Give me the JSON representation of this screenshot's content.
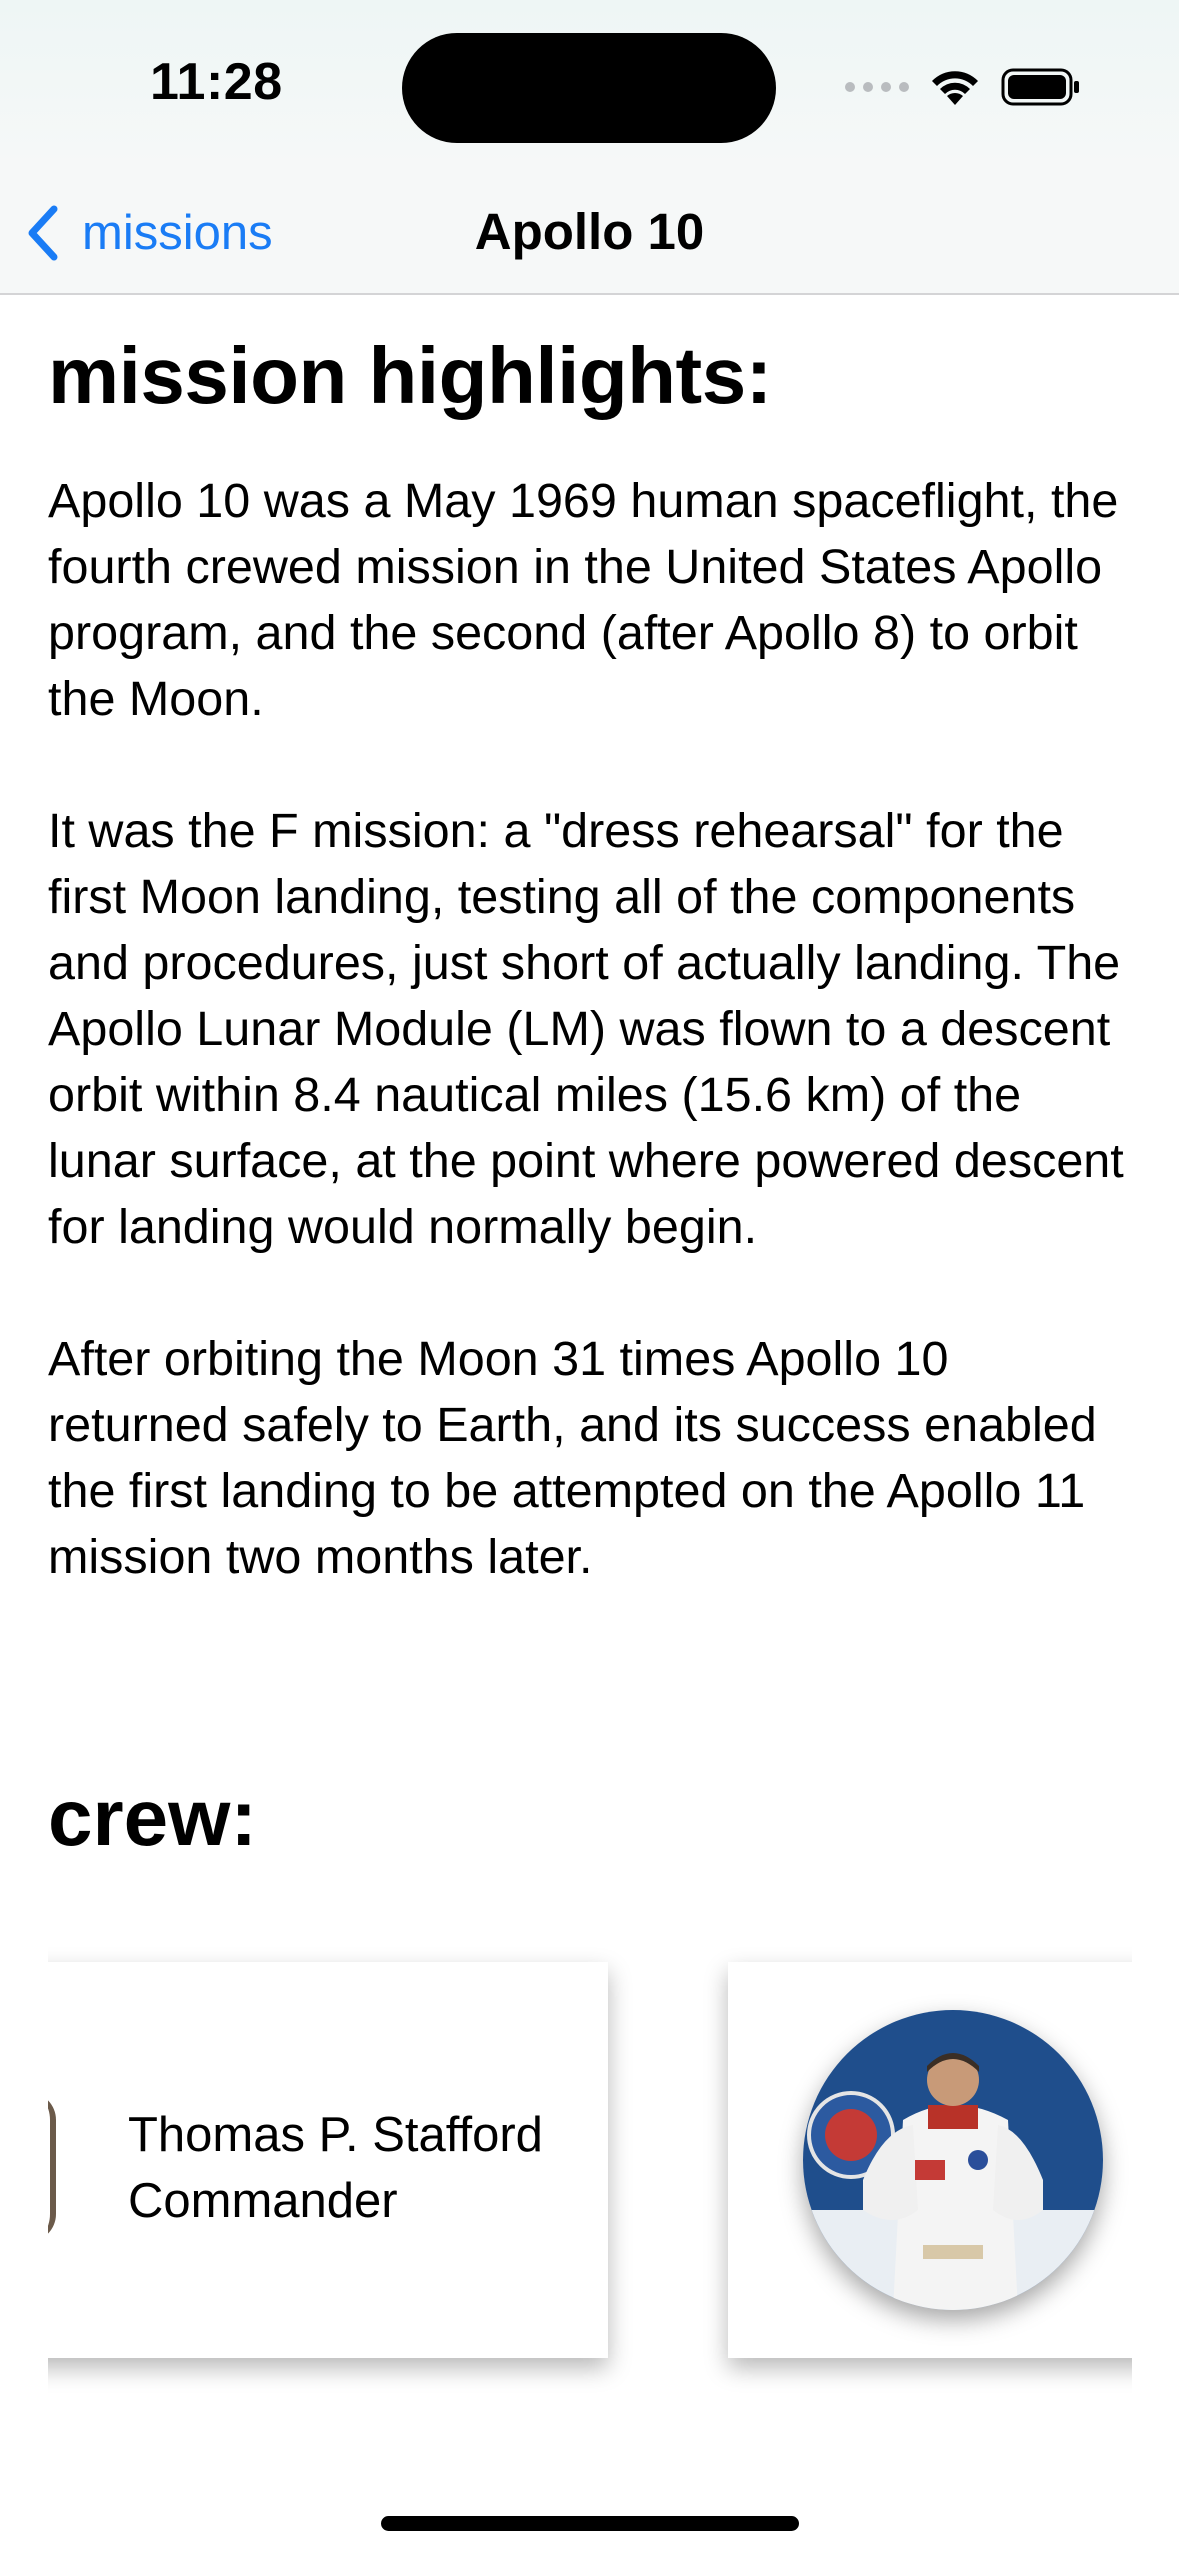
{
  "status": {
    "time": "11:28"
  },
  "nav": {
    "back_label": "missions",
    "title": "Apollo 10"
  },
  "highlights": {
    "title": "mission highlights:",
    "paragraphs": [
      "Apollo 10 was a May 1969 human spaceflight, the fourth crewed mission in the United States Apollo program, and the second (after Apollo 8) to orbit the Moon.",
      "It was the F mission: a \"dress rehearsal\" for the first Moon landing, testing all of the components and procedures, just short of actually landing. The Apollo Lunar Module (LM) was flown to a descent orbit within 8.4 nautical miles (15.6 km) of the lunar surface, at the point where powered descent for landing would normally begin.",
      "After orbiting the Moon 31 times Apollo 10 returned safely to Earth, and its success enabled the first landing to be attempted on the Apollo 11 mission two months later."
    ]
  },
  "crew": {
    "title": "crew:",
    "members": [
      {
        "name": "Thomas P. Stafford",
        "role": "Commander"
      }
    ]
  },
  "colors": {
    "accent": "#1a7cf5",
    "avatar_bg": "#1f4e8c"
  }
}
